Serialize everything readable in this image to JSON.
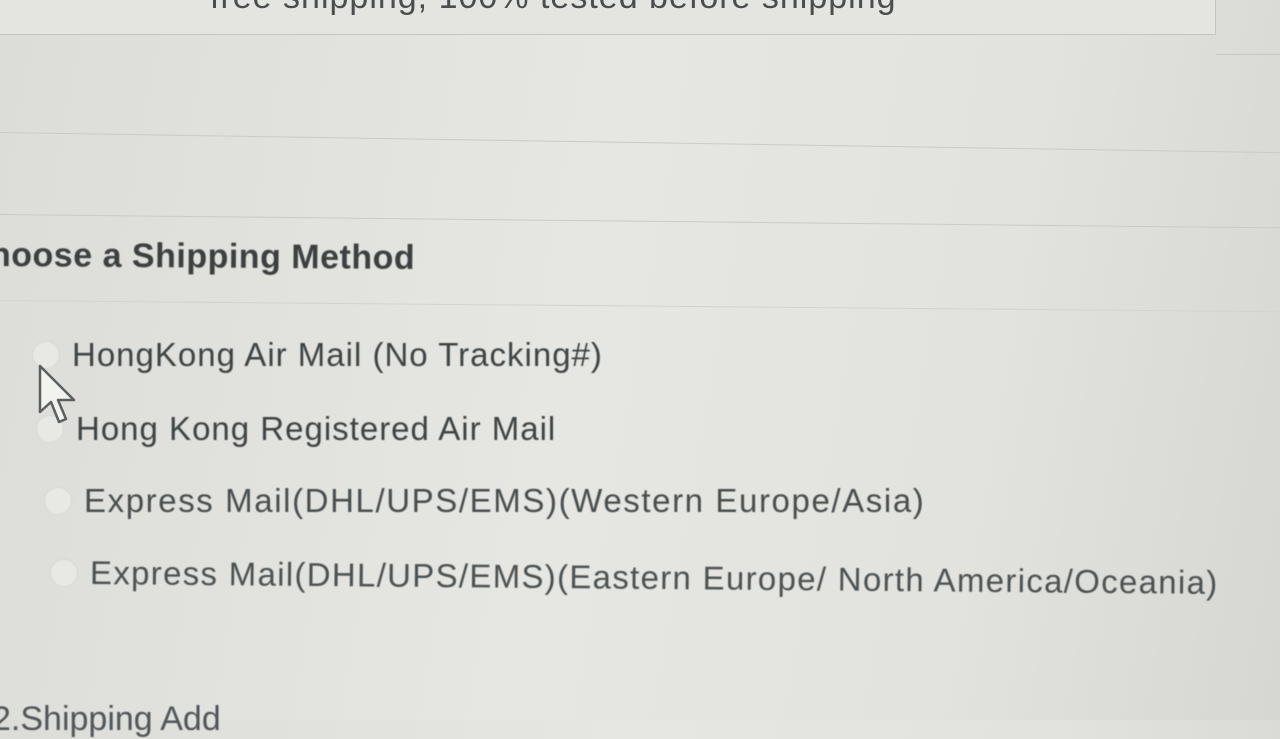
{
  "banner": {
    "text": "free shipping, 100% tested before shipping"
  },
  "shipping": {
    "title": "hoose a Shipping Method",
    "options": [
      {
        "label": "HongKong Air Mail (No Tracking#)",
        "selected": false
      },
      {
        "label": "Hong Kong Registered Air Mail",
        "selected": false
      },
      {
        "label": "Express Mail(DHL/UPS/EMS)(Western Europe/Asia)",
        "selected": false
      },
      {
        "label": "Express Mail(DHL/UPS/EMS)(Eastern Europe/ North America/Oceania)",
        "selected": false
      }
    ]
  },
  "footer": {
    "partial_text": "2.Shipping Add"
  },
  "cursor": {
    "icon": "mouse-pointer-icon"
  }
}
